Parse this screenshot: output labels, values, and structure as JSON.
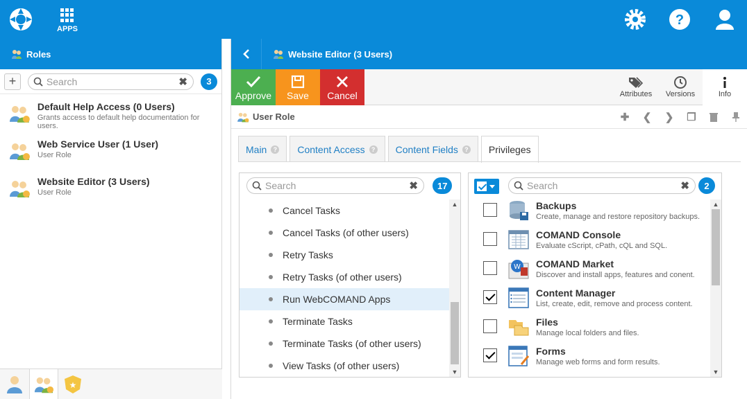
{
  "topbar": {
    "apps_label": "APPS",
    "icons": [
      "settings-icon",
      "help-icon",
      "user-icon"
    ]
  },
  "left": {
    "title": "Roles",
    "search_placeholder": "Search",
    "count": "3",
    "roles": [
      {
        "name": "Default Help Access (0 Users)",
        "desc": "Grants access to default help documentation for users."
      },
      {
        "name": "Web Service User (1 User)",
        "desc": "User Role"
      },
      {
        "name": "Website Editor (3 Users)",
        "desc": "User Role"
      }
    ]
  },
  "right": {
    "title": "Website Editor (3 Users)",
    "actions": {
      "approve": "Approve",
      "save": "Save",
      "cancel": "Cancel"
    },
    "tools": {
      "attributes": "Attributes",
      "versions": "Versions",
      "info": "Info"
    },
    "role_label": "User Role",
    "tabs": [
      "Main",
      "Content Access",
      "Content Fields",
      "Privileges"
    ],
    "active_tab": "Privileges"
  },
  "privileges_list": {
    "search_placeholder": "Search",
    "count": "17",
    "items": [
      "Cancel Tasks",
      "Cancel Tasks (of other users)",
      "Retry Tasks",
      "Retry Tasks (of other users)",
      "Run WebCOMAND Apps",
      "Terminate Tasks",
      "Terminate Tasks (of other users)",
      "View Tasks (of other users)"
    ],
    "selected": "Run WebCOMAND Apps"
  },
  "apps_list": {
    "search_placeholder": "Search",
    "count": "2",
    "items": [
      {
        "name": "Backups",
        "desc": "Create, manage and restore repository backups.",
        "checked": false
      },
      {
        "name": "COMAND Console",
        "desc": "Evaluate cScript, cPath, cQL and SQL.",
        "checked": false
      },
      {
        "name": "COMAND Market",
        "desc": "Discover and install apps, features and conent.",
        "checked": false
      },
      {
        "name": "Content Manager",
        "desc": "List, create, edit, remove and process content.",
        "checked": true
      },
      {
        "name": "Files",
        "desc": "Manage local folders and files.",
        "checked": false
      },
      {
        "name": "Forms",
        "desc": "Manage web forms and form results.",
        "checked": true
      }
    ]
  },
  "colors": {
    "brand": "#0a8ad9",
    "approve": "#4caf50",
    "save": "#f7941d",
    "cancel": "#d32f2f"
  }
}
